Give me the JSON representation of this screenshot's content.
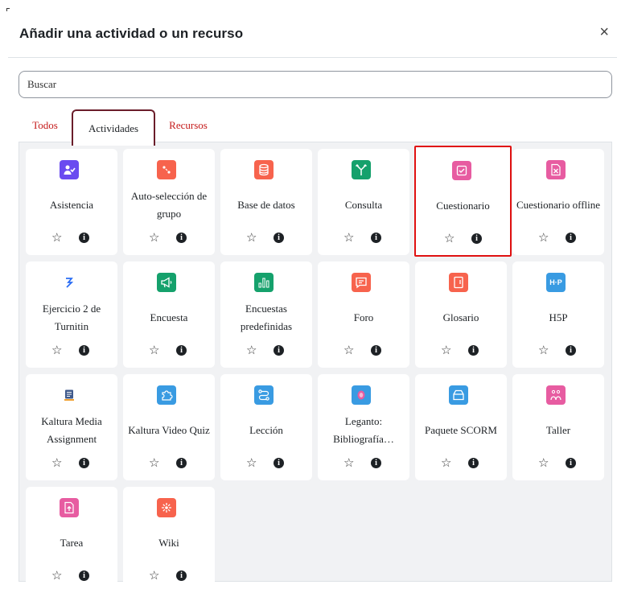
{
  "dialog": {
    "title": "Añadir una actividad o un recurso",
    "close_symbol": "×"
  },
  "search": {
    "placeholder": "Buscar"
  },
  "tabs": [
    {
      "label": "Todos",
      "active": false
    },
    {
      "label": "Actividades",
      "active": true
    },
    {
      "label": "Recursos",
      "active": false
    }
  ],
  "star_symbol": "☆",
  "info_symbol": "i",
  "activities": [
    {
      "name": "Asistencia",
      "icon": "attendance-icon",
      "color": "#6a4bf0"
    },
    {
      "name": "Auto-selección de grupo",
      "icon": "group-choice-icon",
      "color": "#f7634d"
    },
    {
      "name": "Base de datos",
      "icon": "database-icon",
      "color": "#f7634d"
    },
    {
      "name": "Consulta",
      "icon": "choice-icon",
      "color": "#15a16c"
    },
    {
      "name": "Cuestionario",
      "icon": "quiz-icon",
      "color": "#e75ca1",
      "highlighted": true
    },
    {
      "name": "Cuestionario offline",
      "icon": "offline-quiz-icon",
      "color": "#e75ca1"
    },
    {
      "name": "Ejercicio 2 de Turnitin",
      "icon": "turnitin-icon",
      "color": "#ffffff"
    },
    {
      "name": "Encuesta",
      "icon": "megaphone-icon",
      "color": "#15a16c"
    },
    {
      "name": "Encuestas predefinidas",
      "icon": "bar-chart-icon",
      "color": "#15a16c"
    },
    {
      "name": "Foro",
      "icon": "forum-icon",
      "color": "#f7634d"
    },
    {
      "name": "Glosario",
      "icon": "glossary-icon",
      "color": "#f7634d"
    },
    {
      "name": "H5P",
      "icon": "h5p-icon",
      "color": "#399be2",
      "glyph": "H·P"
    },
    {
      "name": "Kaltura Media Assignment",
      "icon": "kaltura-assignment-icon",
      "color": "#ffffff"
    },
    {
      "name": "Kaltura Video Quiz",
      "icon": "puzzle-icon",
      "color": "#399be2"
    },
    {
      "name": "Lección",
      "icon": "lesson-icon",
      "color": "#399be2"
    },
    {
      "name": "Leganto: Bibliografía…",
      "icon": "leganto-icon",
      "color": "#399be2"
    },
    {
      "name": "Paquete SCORM",
      "icon": "scorm-icon",
      "color": "#399be2"
    },
    {
      "name": "Taller",
      "icon": "workshop-icon",
      "color": "#e75ca1"
    },
    {
      "name": "Tarea",
      "icon": "assignment-icon",
      "color": "#e75ca1"
    },
    {
      "name": "Wiki",
      "icon": "wiki-icon",
      "color": "#f7634d"
    }
  ]
}
